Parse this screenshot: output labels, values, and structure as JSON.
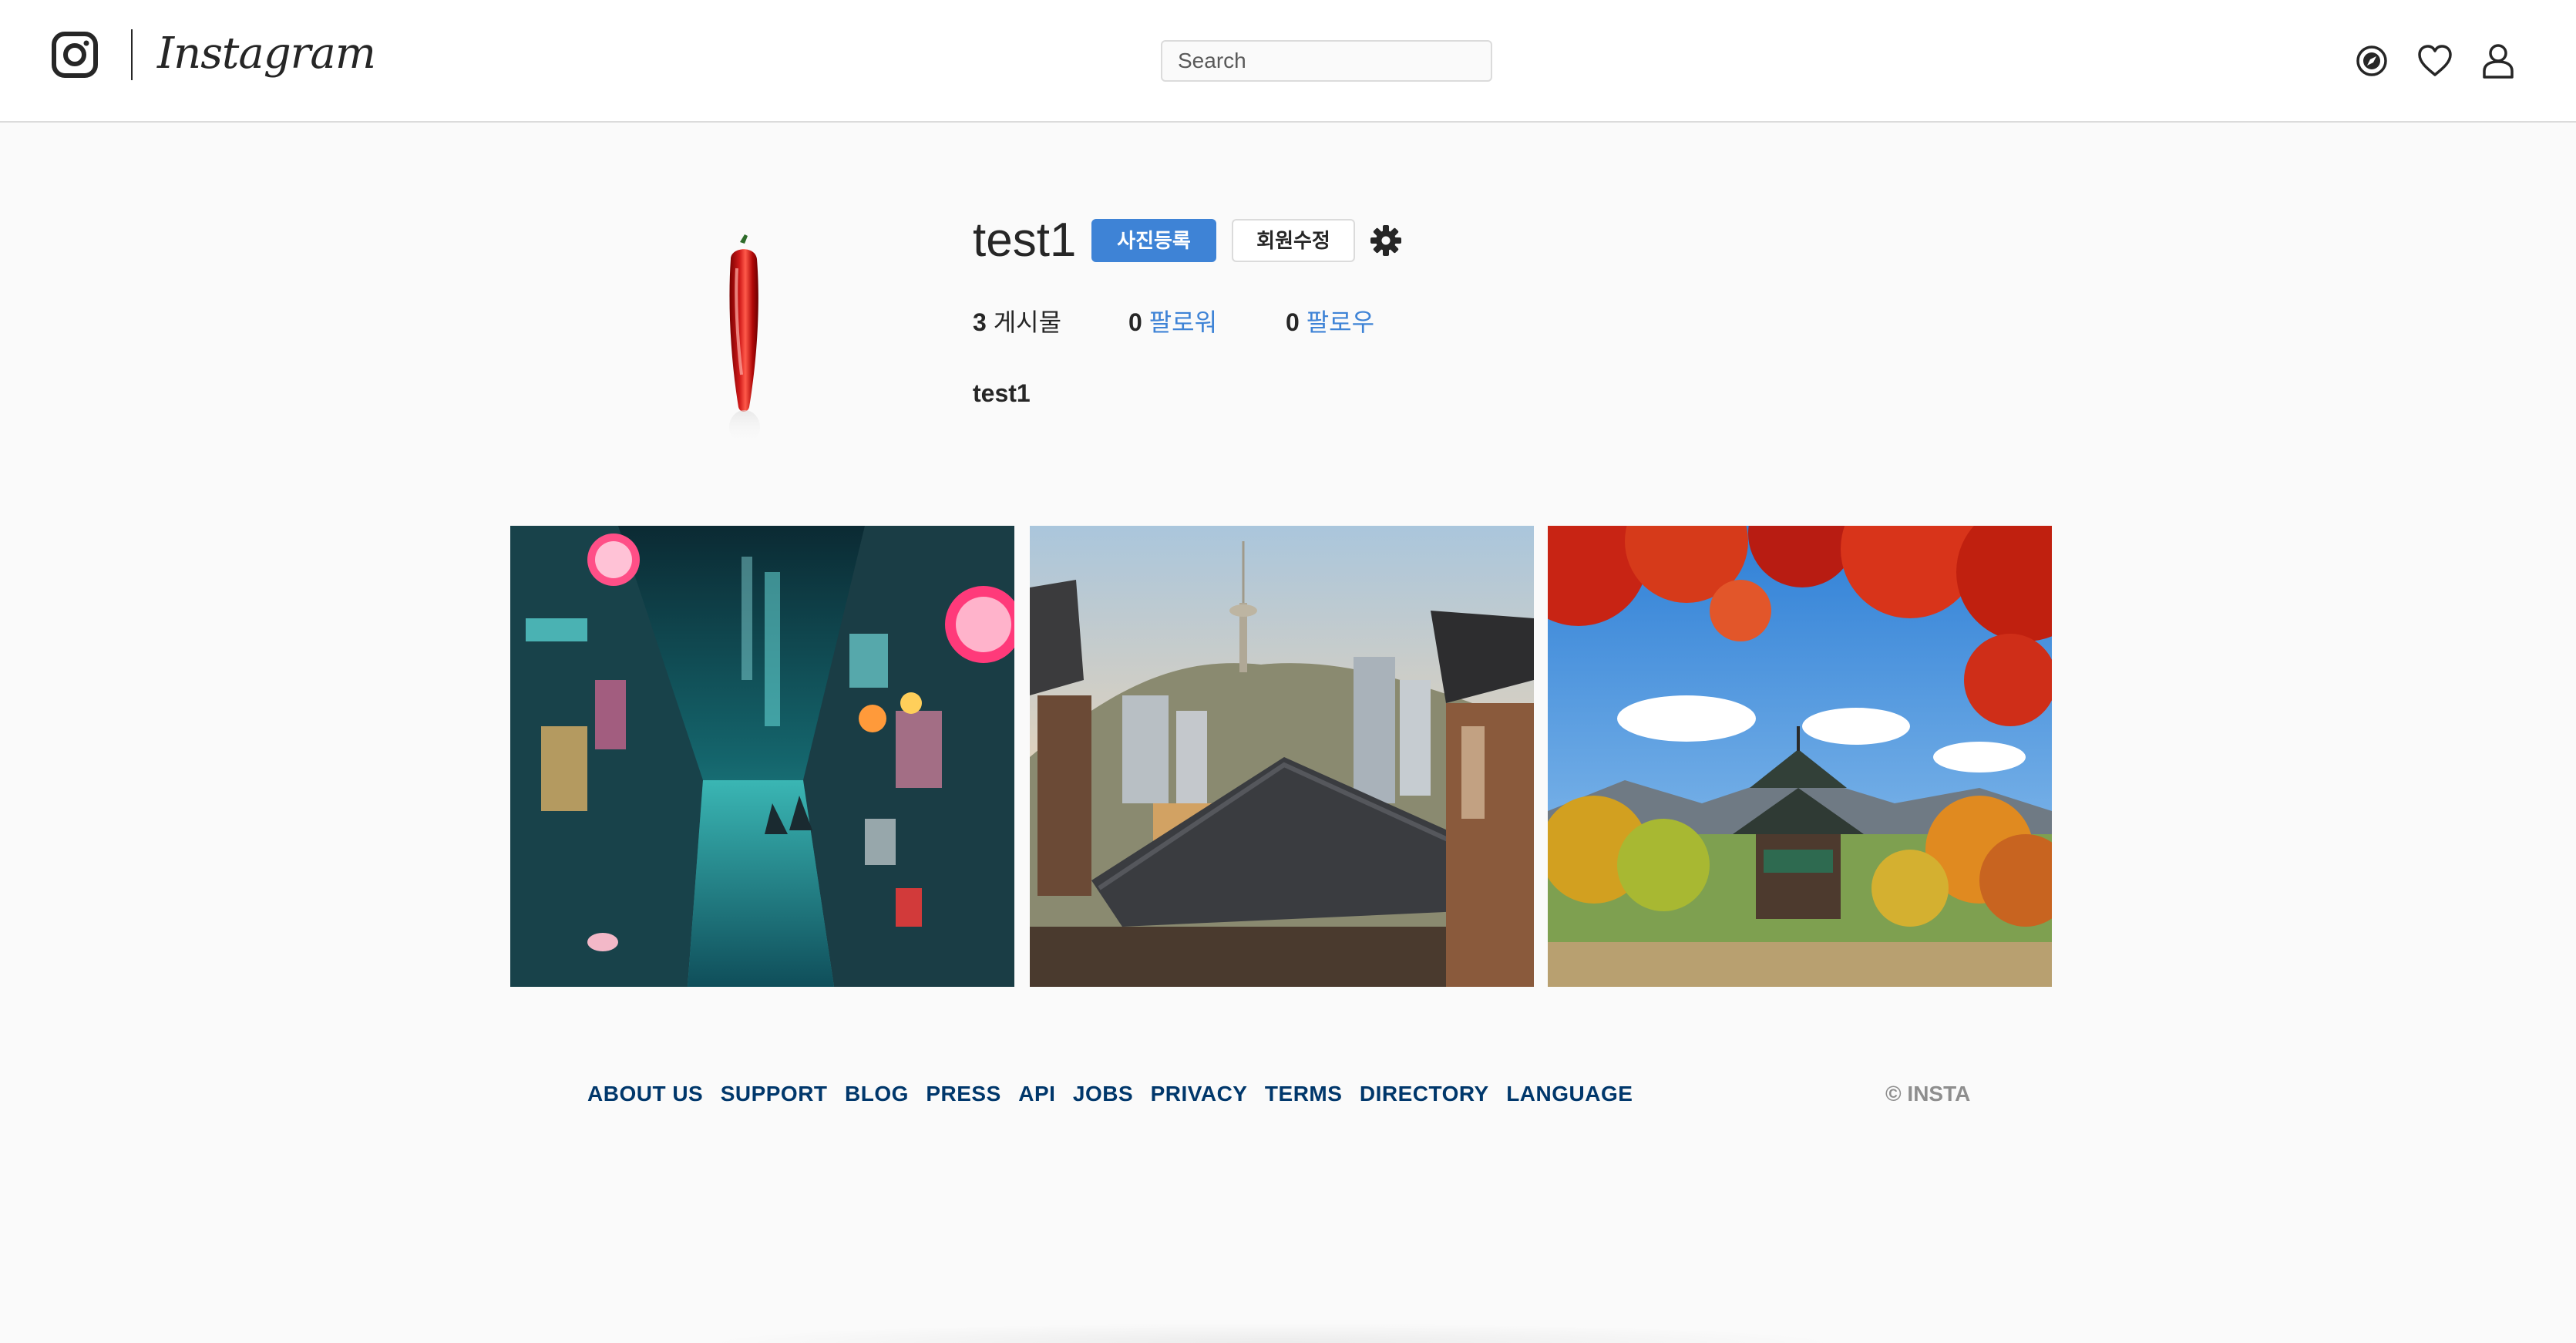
{
  "header": {
    "logo_text": "Instagram",
    "search": {
      "placeholder": "Search",
      "value": ""
    },
    "icons": [
      "compass-icon",
      "heart-icon",
      "user-icon"
    ]
  },
  "profile": {
    "username": "test1",
    "upload_button": "사진등록",
    "edit_button": "회원수정",
    "settings_icon": "gear-icon",
    "stats": {
      "posts": {
        "count": "3",
        "label": "게시물"
      },
      "followers": {
        "count": "0",
        "label": "팔로워"
      },
      "following": {
        "count": "0",
        "label": "팔로우"
      }
    },
    "name": "test1"
  },
  "photos": [
    {
      "subject": "neon-street-night"
    },
    {
      "subject": "hanok-rooftops-tower"
    },
    {
      "subject": "palace-pavilion-autumn"
    }
  ],
  "footer": {
    "links": [
      "ABOUT US",
      "SUPPORT",
      "BLOG",
      "PRESS",
      "API",
      "JOBS",
      "PRIVACY",
      "TERMS",
      "DIRECTORY",
      "LANGUAGE"
    ],
    "copyright": "© INSTA"
  },
  "colors": {
    "accent": "#3e83d6",
    "link": "#00376b",
    "background": "#fafafa"
  }
}
